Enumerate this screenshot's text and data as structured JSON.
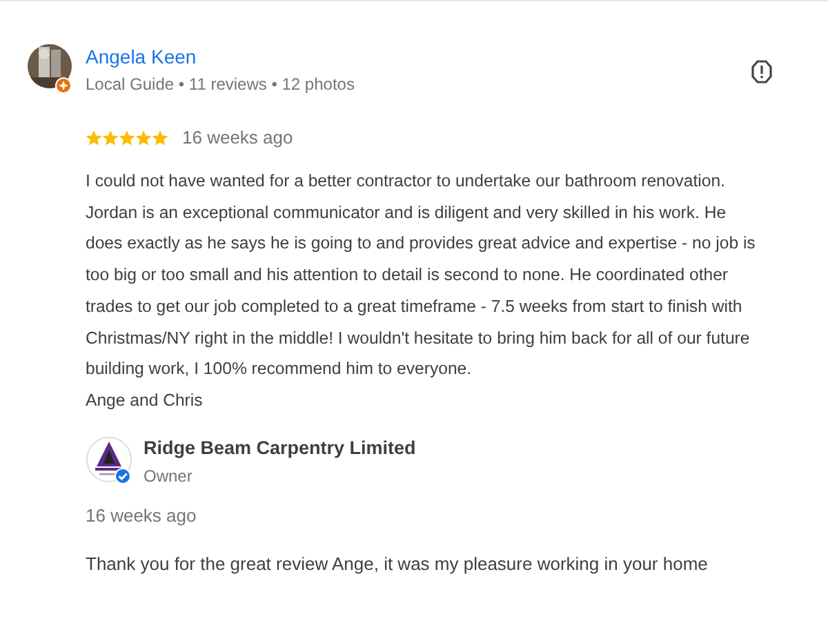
{
  "review": {
    "author": "Angela Keen",
    "meta": "Local Guide • 11 reviews • 12 photos",
    "stars": 5,
    "time": "16 weeks ago",
    "text": "I could not have wanted for a better contractor to undertake our bathroom renovation. Jordan is an exceptional communicator and is diligent and very skilled in his work. He does exactly as he says he is going to and provides great advice and expertise - no job is too big or too small and his attention to detail is second to none. He coordinated other trades to get our job completed to a great timeframe - 7.5 weeks from start to finish with Christmas/NY right in the middle! I wouldn't hesitate to bring him back for all of our future building work, I 100% recommend him to everyone.\nAnge and Chris"
  },
  "reply": {
    "author": "Ridge Beam Carpentry Limited",
    "role": "Owner",
    "time": "16 weeks ago",
    "text": "Thank you for the great review Ange, it was my pleasure working in your home"
  }
}
